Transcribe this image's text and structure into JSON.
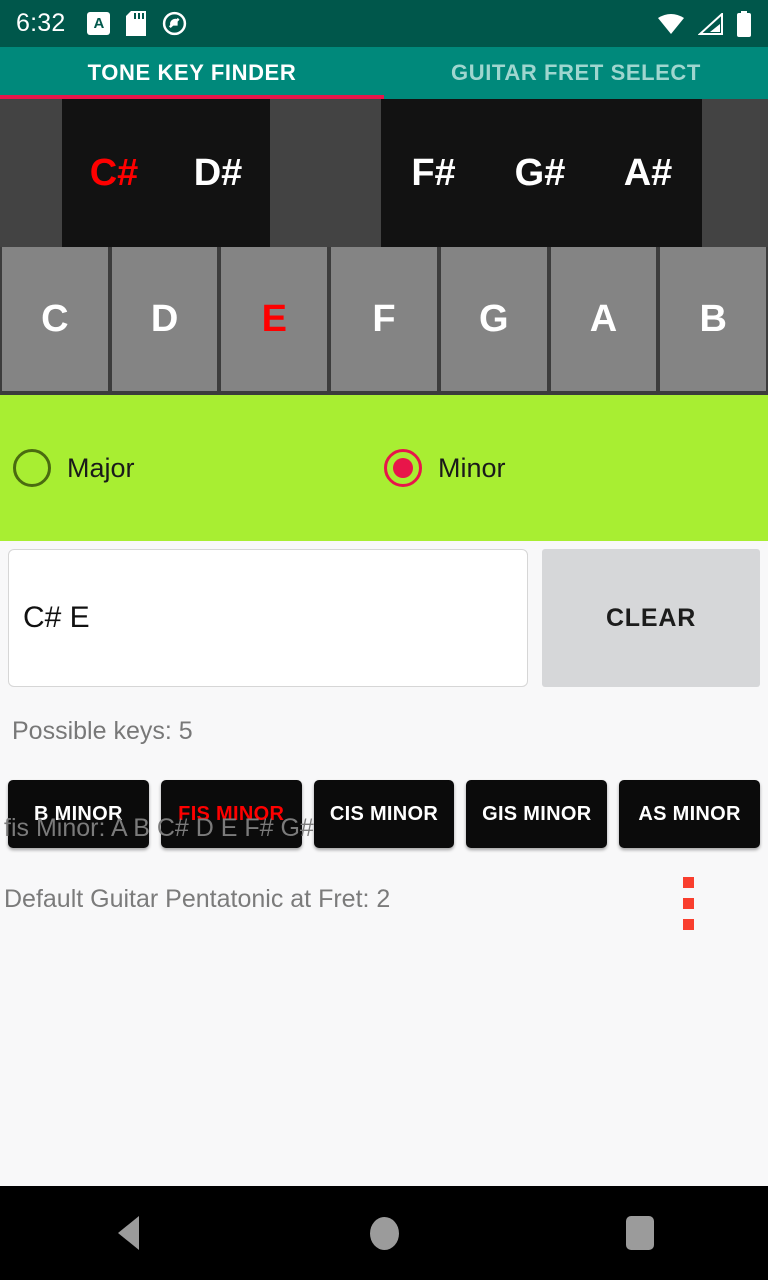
{
  "statusbar": {
    "clock": "6:32",
    "icons_left": [
      "a-badge-icon",
      "sd-card-icon",
      "do-not-disturb-icon"
    ],
    "icons_right": [
      "wifi-icon",
      "cellular-signal-icon",
      "battery-icon"
    ],
    "a_badge_letter": "A"
  },
  "tabs": [
    {
      "label": "TONE KEY FINDER",
      "active": true
    },
    {
      "label": "GUITAR FRET SELECT",
      "active": false
    }
  ],
  "piano": {
    "black_keys": [
      {
        "label": "",
        "is_key": false,
        "selected": false,
        "width": 62
      },
      {
        "label": "C#",
        "is_key": true,
        "selected": true,
        "width": 104
      },
      {
        "label": "D#",
        "is_key": true,
        "selected": false,
        "width": 104
      },
      {
        "label": "",
        "is_key": false,
        "selected": false,
        "width": 111
      },
      {
        "label": "F#",
        "is_key": true,
        "selected": false,
        "width": 105
      },
      {
        "label": "G#",
        "is_key": true,
        "selected": false,
        "width": 108
      },
      {
        "label": "A#",
        "is_key": true,
        "selected": false,
        "width": 108
      },
      {
        "label": "",
        "is_key": false,
        "selected": false,
        "width": 66
      }
    ],
    "white_keys": [
      {
        "label": "C",
        "selected": false
      },
      {
        "label": "D",
        "selected": false
      },
      {
        "label": "E",
        "selected": true
      },
      {
        "label": "F",
        "selected": false
      },
      {
        "label": "G",
        "selected": false
      },
      {
        "label": "A",
        "selected": false
      },
      {
        "label": "B",
        "selected": false
      }
    ]
  },
  "mode": {
    "options": [
      {
        "label": "Major",
        "selected": false
      },
      {
        "label": "Minor",
        "selected": true
      }
    ]
  },
  "input": {
    "notes_value": "C# E",
    "notes_placeholder": "",
    "clear_label": "CLEAR"
  },
  "results": {
    "possible_keys_text": "Possible keys: 5",
    "keys": [
      {
        "label": "B MINOR",
        "selected": false
      },
      {
        "label": "FIS MINOR",
        "selected": true
      },
      {
        "label": "CIS MINOR",
        "selected": false
      },
      {
        "label": "GIS MINOR",
        "selected": false
      },
      {
        "label": "AS MINOR",
        "selected": false
      }
    ]
  },
  "info": {
    "scale_line": "fis Minor: A B C# D E F# G#",
    "fret_line": "Default Guitar Pentatonic at Fret: 2"
  },
  "navbar": {
    "back": "back-icon",
    "home": "home-icon",
    "recents": "recents-icon"
  },
  "colors": {
    "status_bar": "#00574b",
    "tab_bar": "#00897b",
    "tab_indicator": "#e8154a",
    "mode_panel": "#a8ee32",
    "selected_note": "#ff0000",
    "white_key": "#848484",
    "black_key": "#121212",
    "overflow_dot": "#f93e2e"
  }
}
